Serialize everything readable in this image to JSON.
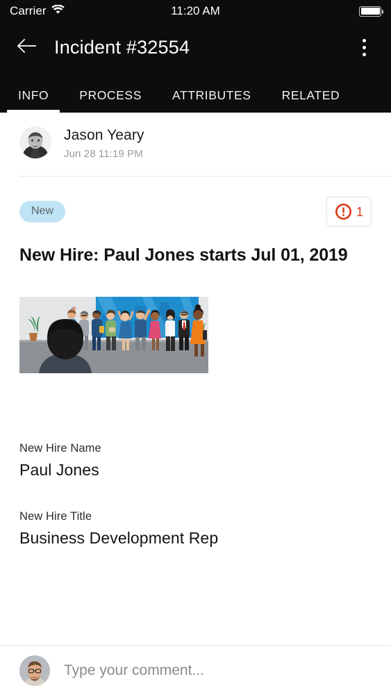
{
  "statusbar": {
    "carrier": "Carrier",
    "time": "11:20 AM",
    "wifi_icon": "wifi-icon",
    "battery_icon": "battery-full-icon"
  },
  "appbar": {
    "back_icon": "arrow-left-icon",
    "title": "Incident #32554",
    "menu_icon": "overflow-menu-icon"
  },
  "tabs": [
    {
      "label": "INFO",
      "active": true
    },
    {
      "label": "PROCESS",
      "active": false
    },
    {
      "label": "ATTRIBUTES",
      "active": false
    },
    {
      "label": "RELATED",
      "active": false
    }
  ],
  "author": {
    "name": "Jason Yeary",
    "timestamp": "Jun 28 11:19 PM",
    "avatar": "user-avatar-photo"
  },
  "record": {
    "state_label": "New",
    "priority_count": "1",
    "priority_icon": "exclamation-circle-icon",
    "title": "New Hire: Paul Jones starts Jul 01, 2019",
    "hero_image": "new-hire-welcome-illustration"
  },
  "fields": [
    {
      "label": "New Hire Name",
      "value": "Paul Jones"
    },
    {
      "label": "New Hire Title",
      "value": "Business Development Rep"
    }
  ],
  "comment": {
    "placeholder": "Type your comment...",
    "avatar": "current-user-avatar-photo"
  },
  "colors": {
    "appbar_bg": "#0d0d0d",
    "state_pill_bg": "#bfe4f6",
    "priority_red": "#dc3a16",
    "page_bg": "#ffffff",
    "divider": "#e6e6e6"
  }
}
